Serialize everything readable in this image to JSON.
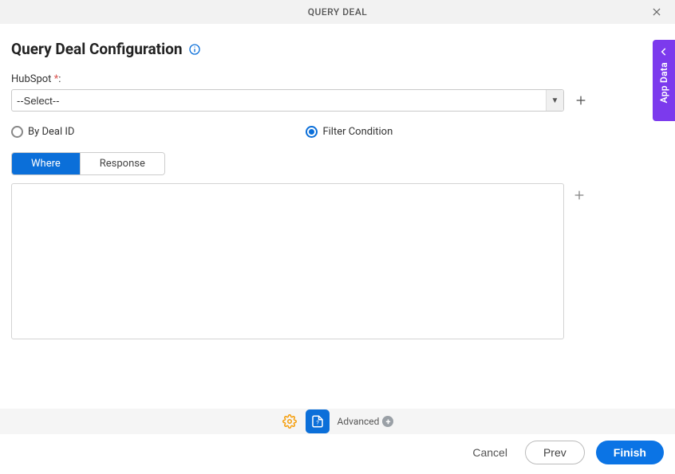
{
  "header": {
    "title": "QUERY DEAL"
  },
  "page": {
    "title": "Query Deal Configuration"
  },
  "connection_field": {
    "label_text": "HubSpot ",
    "required_mark": "*",
    "label_suffix": ":",
    "selected": "--Select--"
  },
  "query_mode": {
    "by_deal_id": "By Deal ID",
    "filter_condition": "Filter Condition",
    "selected": "filter_condition"
  },
  "tabs": {
    "where": "Where",
    "response": "Response",
    "active": "where"
  },
  "side_panel": {
    "label": "App Data"
  },
  "bottom_toolbar": {
    "advanced": "Advanced"
  },
  "footer": {
    "cancel": "Cancel",
    "prev": "Prev",
    "finish": "Finish"
  }
}
